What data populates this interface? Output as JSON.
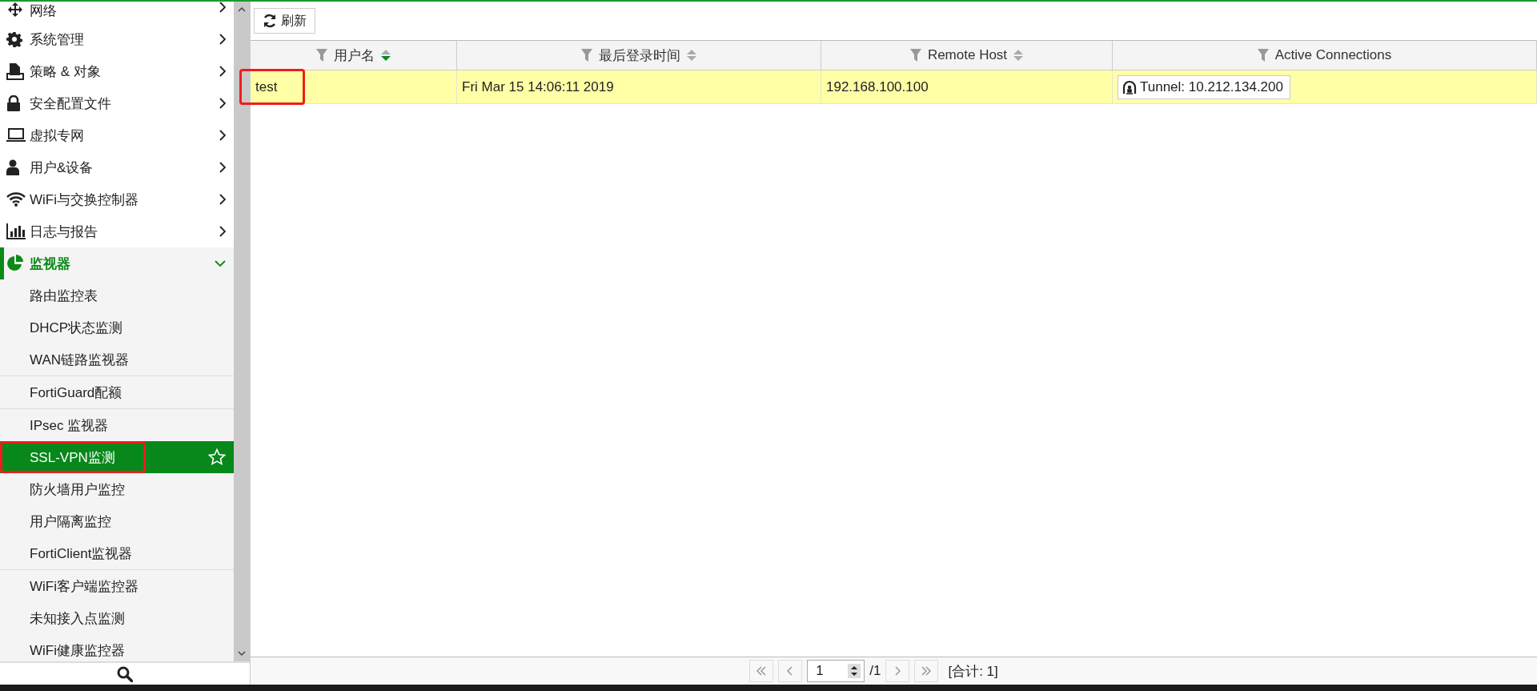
{
  "sidebar": {
    "items": [
      {
        "label": "网络",
        "expanded": false
      },
      {
        "label": "系统管理",
        "expanded": false
      },
      {
        "label": "策略 & 对象",
        "expanded": false
      },
      {
        "label": "安全配置文件",
        "expanded": false
      },
      {
        "label": "虚拟专网",
        "expanded": false
      },
      {
        "label": "用户&设备",
        "expanded": false
      },
      {
        "label": "WiFi与交换控制器",
        "expanded": false
      },
      {
        "label": "日志与报告",
        "expanded": false
      },
      {
        "label": "监视器",
        "expanded": true,
        "groups": [
          [
            {
              "label": "路由监控表",
              "selected": false
            },
            {
              "label": "DHCP状态监测",
              "selected": false
            },
            {
              "label": "WAN链路监视器",
              "selected": false
            }
          ],
          [
            {
              "label": "FortiGuard配额",
              "selected": false
            }
          ],
          [
            {
              "label": "IPsec 监视器",
              "selected": false
            },
            {
              "label": "SSL-VPN监测",
              "selected": true
            },
            {
              "label": "防火墙用户监控",
              "selected": false
            },
            {
              "label": "用户隔离监控",
              "selected": false
            },
            {
              "label": "FortiClient监视器",
              "selected": false
            }
          ],
          [
            {
              "label": "WiFi客户端监控器",
              "selected": false
            },
            {
              "label": "未知接入点监测",
              "selected": false
            },
            {
              "label": "WiFi健康监控器",
              "selected": false
            }
          ]
        ]
      }
    ]
  },
  "toolbar": {
    "refresh_button": "刷新"
  },
  "table": {
    "columns": [
      {
        "label": "用户名",
        "sort_active": true
      },
      {
        "label": "最后登录时间",
        "sort_active": false
      },
      {
        "label": "Remote Host",
        "sort_active": false
      },
      {
        "label": "Active Connections"
      }
    ],
    "rows": [
      {
        "selected": true,
        "cells": [
          "test",
          "Fri Mar 15 14:06:11 2019",
          "192.168.100.100"
        ],
        "connection": "Tunnel: 10.212.134.200"
      }
    ]
  },
  "pagination": {
    "page": "1",
    "total_pages": "/1",
    "total": "[合计: 1]"
  }
}
